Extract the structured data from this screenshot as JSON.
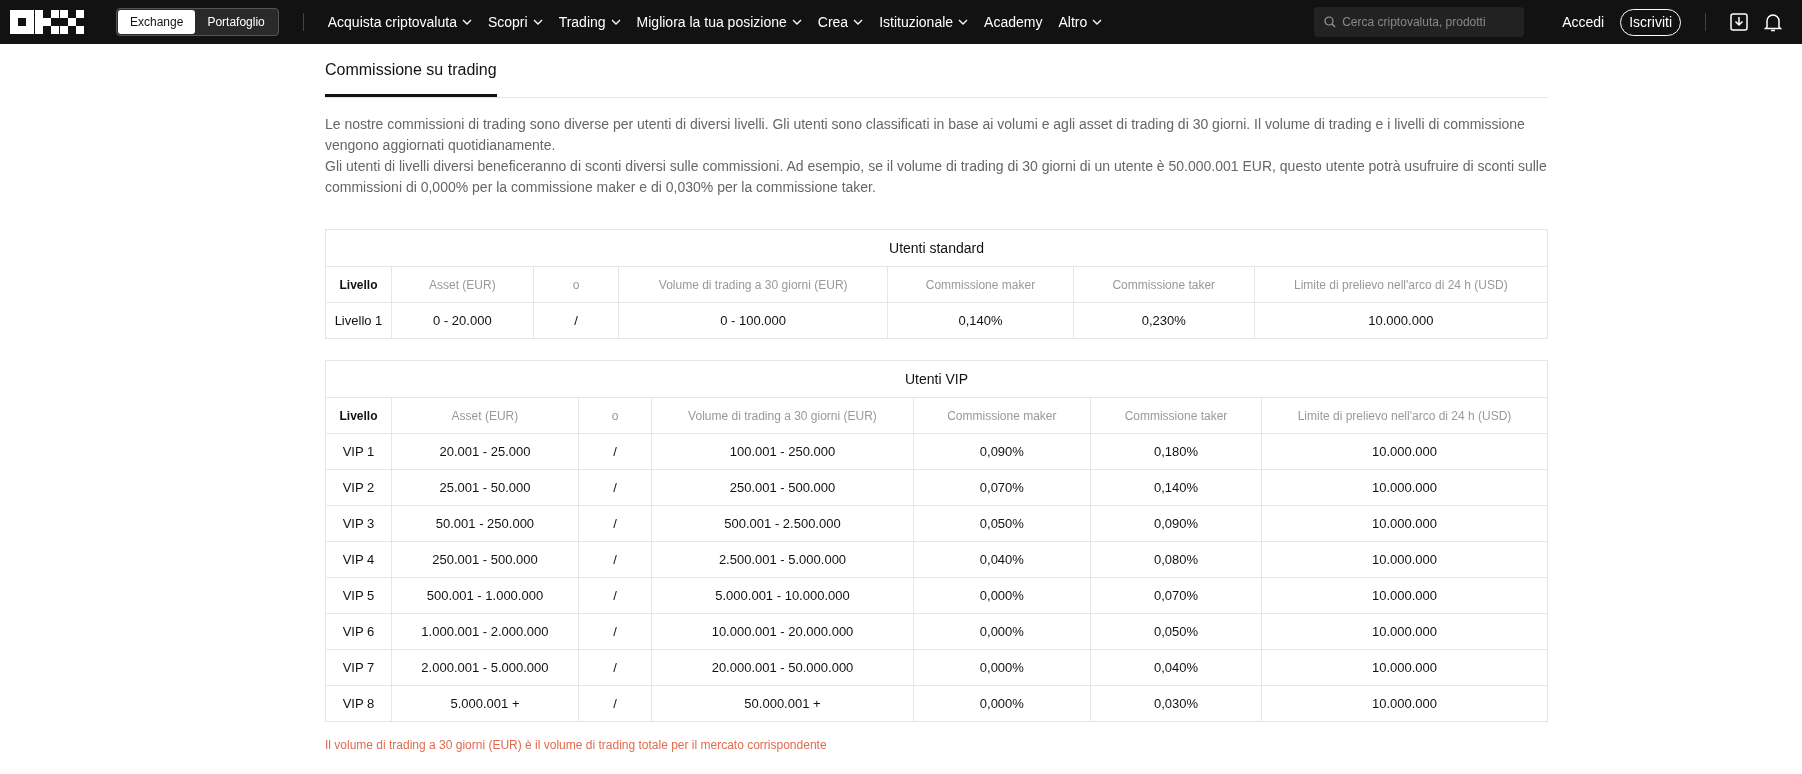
{
  "header": {
    "segments": [
      {
        "label": "Exchange",
        "selected": true
      },
      {
        "label": "Portafoglio",
        "selected": false
      }
    ],
    "menu": [
      {
        "label": "Acquista criptovaluta",
        "dropdown": true
      },
      {
        "label": "Scopri",
        "dropdown": true
      },
      {
        "label": "Trading",
        "dropdown": true
      },
      {
        "label": "Migliora la tua posizione",
        "dropdown": true
      },
      {
        "label": "Crea",
        "dropdown": true
      },
      {
        "label": "Istituzionale",
        "dropdown": true
      },
      {
        "label": "Academy",
        "dropdown": false
      },
      {
        "label": "Altro",
        "dropdown": true
      }
    ],
    "search": {
      "placeholder": "Cerca criptovaluta, prodotti"
    },
    "login": "Accedi",
    "signup": "Iscriviti"
  },
  "tabs": [
    {
      "label": "Commissione su trading",
      "selected": true
    }
  ],
  "paragraphs": [
    "Le nostre commissioni di trading sono diverse per utenti di diversi livelli. Gli utenti sono classificati in base ai volumi e agli asset di trading di 30 giorni. Il volume di trading e i livelli di commissione vengono aggiornati quotidianamente.",
    "Gli utenti di livelli diversi beneficeranno di sconti diversi sulle commissioni. Ad esempio, se il volume di trading di 30 giorni di un utente è 50.000.001 EUR, questo utente potrà usufruire di sconti sulle commissioni di 0,000% per la commissione maker e di 0,030% per la commissione taker."
  ],
  "tables": [
    {
      "title": "Utenti standard",
      "columns": [
        "Livello",
        "Asset (EUR)",
        "o",
        "Volume di trading a 30 giorni (EUR)",
        "Commissione maker",
        "Commissione taker",
        "Limite di prelievo nell'arco di 24 h (USD)"
      ],
      "rows": [
        [
          "Livello 1",
          "0 - 20.000",
          "/",
          "0 - 100.000",
          "0,140%",
          "0,230%",
          "10.000.000"
        ]
      ]
    },
    {
      "title": "Utenti VIP",
      "columns": [
        "Livello",
        "Asset (EUR)",
        "o",
        "Volume di trading a 30 giorni (EUR)",
        "Commissione maker",
        "Commissione taker",
        "Limite di prelievo nell'arco di 24 h (USD)"
      ],
      "rows": [
        [
          "VIP 1",
          "20.001 - 25.000",
          "/",
          "100.001 - 250.000",
          "0,090%",
          "0,180%",
          "10.000.000"
        ],
        [
          "VIP 2",
          "25.001 - 50.000",
          "/",
          "250.001 - 500.000",
          "0,070%",
          "0,140%",
          "10.000.000"
        ],
        [
          "VIP 3",
          "50.001 - 250.000",
          "/",
          "500.001 - 2.500.000",
          "0,050%",
          "0,090%",
          "10.000.000"
        ],
        [
          "VIP 4",
          "250.001 - 500.000",
          "/",
          "2.500.001 - 5.000.000",
          "0,040%",
          "0,080%",
          "10.000.000"
        ],
        [
          "VIP 5",
          "500.001 - 1.000.000",
          "/",
          "5.000.001 - 10.000.000",
          "0,000%",
          "0,070%",
          "10.000.000"
        ],
        [
          "VIP 6",
          "1.000.001 - 2.000.000",
          "/",
          "10.000.001 - 20.000.000",
          "0,000%",
          "0,050%",
          "10.000.000"
        ],
        [
          "VIP 7",
          "2.000.001 - 5.000.000",
          "/",
          "20.000.001 - 50.000.000",
          "0,000%",
          "0,040%",
          "10.000.000"
        ],
        [
          "VIP 8",
          "5.000.001 +",
          "/",
          "50.000.001 +",
          "0,000%",
          "0,030%",
          "10.000.000"
        ]
      ]
    }
  ],
  "note": "Il volume di trading a 30 giorni (EUR) è il volume di trading totale per il mercato corrispondente"
}
